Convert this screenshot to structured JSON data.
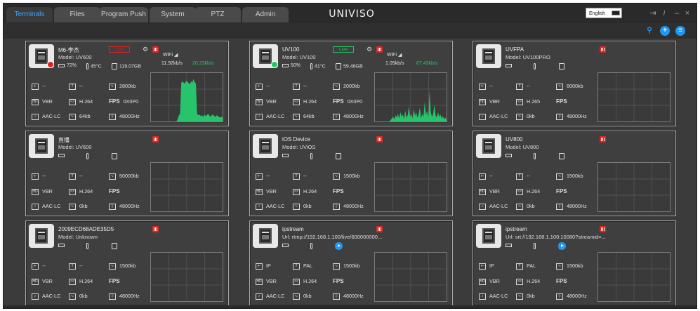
{
  "tabs": [
    {
      "label": "Terminals"
    },
    {
      "label": "Files"
    },
    {
      "label": "Program Push"
    },
    {
      "label": "System"
    },
    {
      "label": "PTZ"
    },
    {
      "label": "Admin"
    }
  ],
  "brand": {
    "logo": "UNIVISO"
  },
  "language": {
    "value": "English"
  },
  "icons": {
    "export": "export-icon",
    "info": "info-icon",
    "minimize": "minimize-icon",
    "close": "close-icon",
    "search": "search-icon",
    "add": "add-icon",
    "menu": "menu-icon"
  },
  "colors": {
    "accent": "#3aa6ff",
    "record": "#e0231c",
    "graph": "#27c46b",
    "online": "#22c55e",
    "offline": "#e0231c"
  },
  "cards": [
    {
      "name": "M6-李杰",
      "model": "Model: UV600",
      "badge": "Live",
      "badge_color": "#e0231c",
      "status_dot": "#e0231c",
      "battery": "72%",
      "temp": "45°C",
      "storage": "119.07GB",
      "wifi": "WiFi",
      "upload": "11.92kb/s",
      "download": "20.23kb/s",
      "r1a": "--",
      "r1b": "--",
      "r1c": "2800kb",
      "r2a": "VBR",
      "r2b": "H.264",
      "r2c": "0X0P0",
      "r3a": "AAC-LC",
      "r3b": "64kb",
      "r3c": "48000Hz",
      "graph": [
        0,
        0,
        0,
        0,
        0,
        0,
        0,
        0,
        0,
        0,
        0,
        0,
        0,
        0,
        0,
        0,
        0,
        0,
        0,
        0,
        0,
        0,
        3,
        8,
        10,
        50,
        52,
        50,
        49,
        53,
        51,
        50,
        48,
        52,
        50,
        55,
        51,
        49,
        10,
        8,
        9,
        7,
        8,
        6,
        9,
        7,
        8,
        10,
        8,
        6,
        8,
        9,
        7,
        6,
        8,
        7,
        6,
        5,
        6,
        5
      ]
    },
    {
      "name": "UV100",
      "model": "Model: UV100",
      "badge": "Live",
      "badge_color": "#22c55e",
      "status_dot": "#22c55e",
      "battery": "50%",
      "temp": "41°C",
      "storage": "59.46GB",
      "wifi": "WiFi",
      "upload": "1.05kb/s",
      "download": "67.43kb/s",
      "r1a": "--",
      "r1b": "--",
      "r1c": "2000kb",
      "r2a": "VBR",
      "r2b": "H.264",
      "r2c": "0X0P0",
      "r3a": "AAC-LC",
      "r3b": "64kb",
      "r3c": "48000Hz",
      "graph": [
        0,
        0,
        0,
        0,
        0,
        0,
        0,
        0,
        0,
        0,
        0,
        0,
        0,
        2,
        4,
        6,
        3,
        8,
        5,
        10,
        4,
        12,
        6,
        9,
        3,
        14,
        5,
        8,
        20,
        6,
        10,
        4,
        16,
        7,
        12,
        5,
        9,
        18,
        4,
        10,
        6,
        25,
        8,
        14,
        5,
        40,
        12,
        6,
        10,
        22,
        8,
        5,
        12,
        6,
        9,
        4,
        7,
        3,
        5,
        2
      ]
    },
    {
      "name": "UVFPA",
      "model": "Model: UV100PRO",
      "badge": "",
      "badge_color": "",
      "status_dot": "",
      "battery": "",
      "temp": "",
      "storage": "",
      "wifi": "",
      "upload": "",
      "download": "",
      "r1a": "--",
      "r1b": "--",
      "r1c": "6000kb",
      "r2a": "VBR",
      "r2b": "H.265",
      "r2c": "",
      "r3a": "AAC-LC",
      "r3b": "0kb",
      "r3c": "48000Hz",
      "graph": []
    },
    {
      "name": "直播",
      "model": "Model: UV600",
      "badge": "",
      "badge_color": "",
      "status_dot": "",
      "battery": "",
      "temp": "",
      "storage": "",
      "wifi": "",
      "upload": "",
      "download": "",
      "r1a": "--",
      "r1b": "--",
      "r1c": "50000kb",
      "r2a": "VBR",
      "r2b": "H.264",
      "r2c": "",
      "r3a": "AAC-LC",
      "r3b": "0kb",
      "r3c": "48000Hz",
      "graph": []
    },
    {
      "name": "iOS Device",
      "model": "Model: UViOS",
      "badge": "",
      "badge_color": "",
      "status_dot": "",
      "battery": "",
      "temp": "",
      "storage": "",
      "wifi": "",
      "upload": "",
      "download": "",
      "r1a": "--",
      "r1b": "--",
      "r1c": "1500kb",
      "r2a": "VBR",
      "r2b": "H.264",
      "r2c": "",
      "r3a": "AAC-LC",
      "r3b": "0kb",
      "r3c": "48000Hz",
      "graph": []
    },
    {
      "name": "UV800",
      "model": "Model: UV800",
      "badge": "",
      "badge_color": "",
      "status_dot": "",
      "battery": "",
      "temp": "",
      "storage": "",
      "wifi": "",
      "upload": "",
      "download": "",
      "r1a": "--",
      "r1b": "--",
      "r1c": "1500kb",
      "r2a": "VBR",
      "r2b": "H.264",
      "r2c": "",
      "r3a": "AAC-LC",
      "r3b": "0kb",
      "r3c": "48000Hz",
      "graph": []
    },
    {
      "name": "2009ECD68ADE35D5",
      "model": "Model: Unknown",
      "badge": "",
      "badge_color": "",
      "status_dot": "",
      "battery": "",
      "temp": "",
      "storage": "",
      "wifi": "",
      "upload": "",
      "download": "",
      "r1a": "--",
      "r1b": "--",
      "r1c": "1500kb",
      "r2a": "VBR",
      "r2b": "H.264",
      "r2c": "",
      "r3a": "AAC-LC",
      "r3b": "0kb",
      "r3c": "48000Hz",
      "graph": []
    },
    {
      "name": "ipstream",
      "model": "Url: rtmp://192.168.1.100/live/600000000...",
      "badge": "",
      "badge_color": "",
      "status_dot": "",
      "battery": "",
      "temp": "",
      "storage": "",
      "wifi": "",
      "upload": "",
      "download": "",
      "r1a": "IP",
      "r1b": "PAL",
      "r1c": "1500kb",
      "r2a": "VBR",
      "r2b": "H.264",
      "r2c": "",
      "r3a": "AAC-LC",
      "r3b": "0kb",
      "r3c": "48000Hz",
      "graph": [],
      "play": true
    },
    {
      "name": "ipstream",
      "model": "Url: srt://192.168.1.100:10080?streamid=...",
      "badge": "",
      "badge_color": "",
      "status_dot": "",
      "battery": "",
      "temp": "",
      "storage": "",
      "wifi": "",
      "upload": "",
      "download": "",
      "r1a": "IP",
      "r1b": "PAL",
      "r1c": "1500kb",
      "r2a": "VBR",
      "r2b": "H.264",
      "r2c": "",
      "r3a": "AAC-LC",
      "r3b": "0kb",
      "r3c": "48000Hz",
      "graph": [],
      "play": true
    }
  ],
  "labels": {
    "fps": "FPS"
  }
}
